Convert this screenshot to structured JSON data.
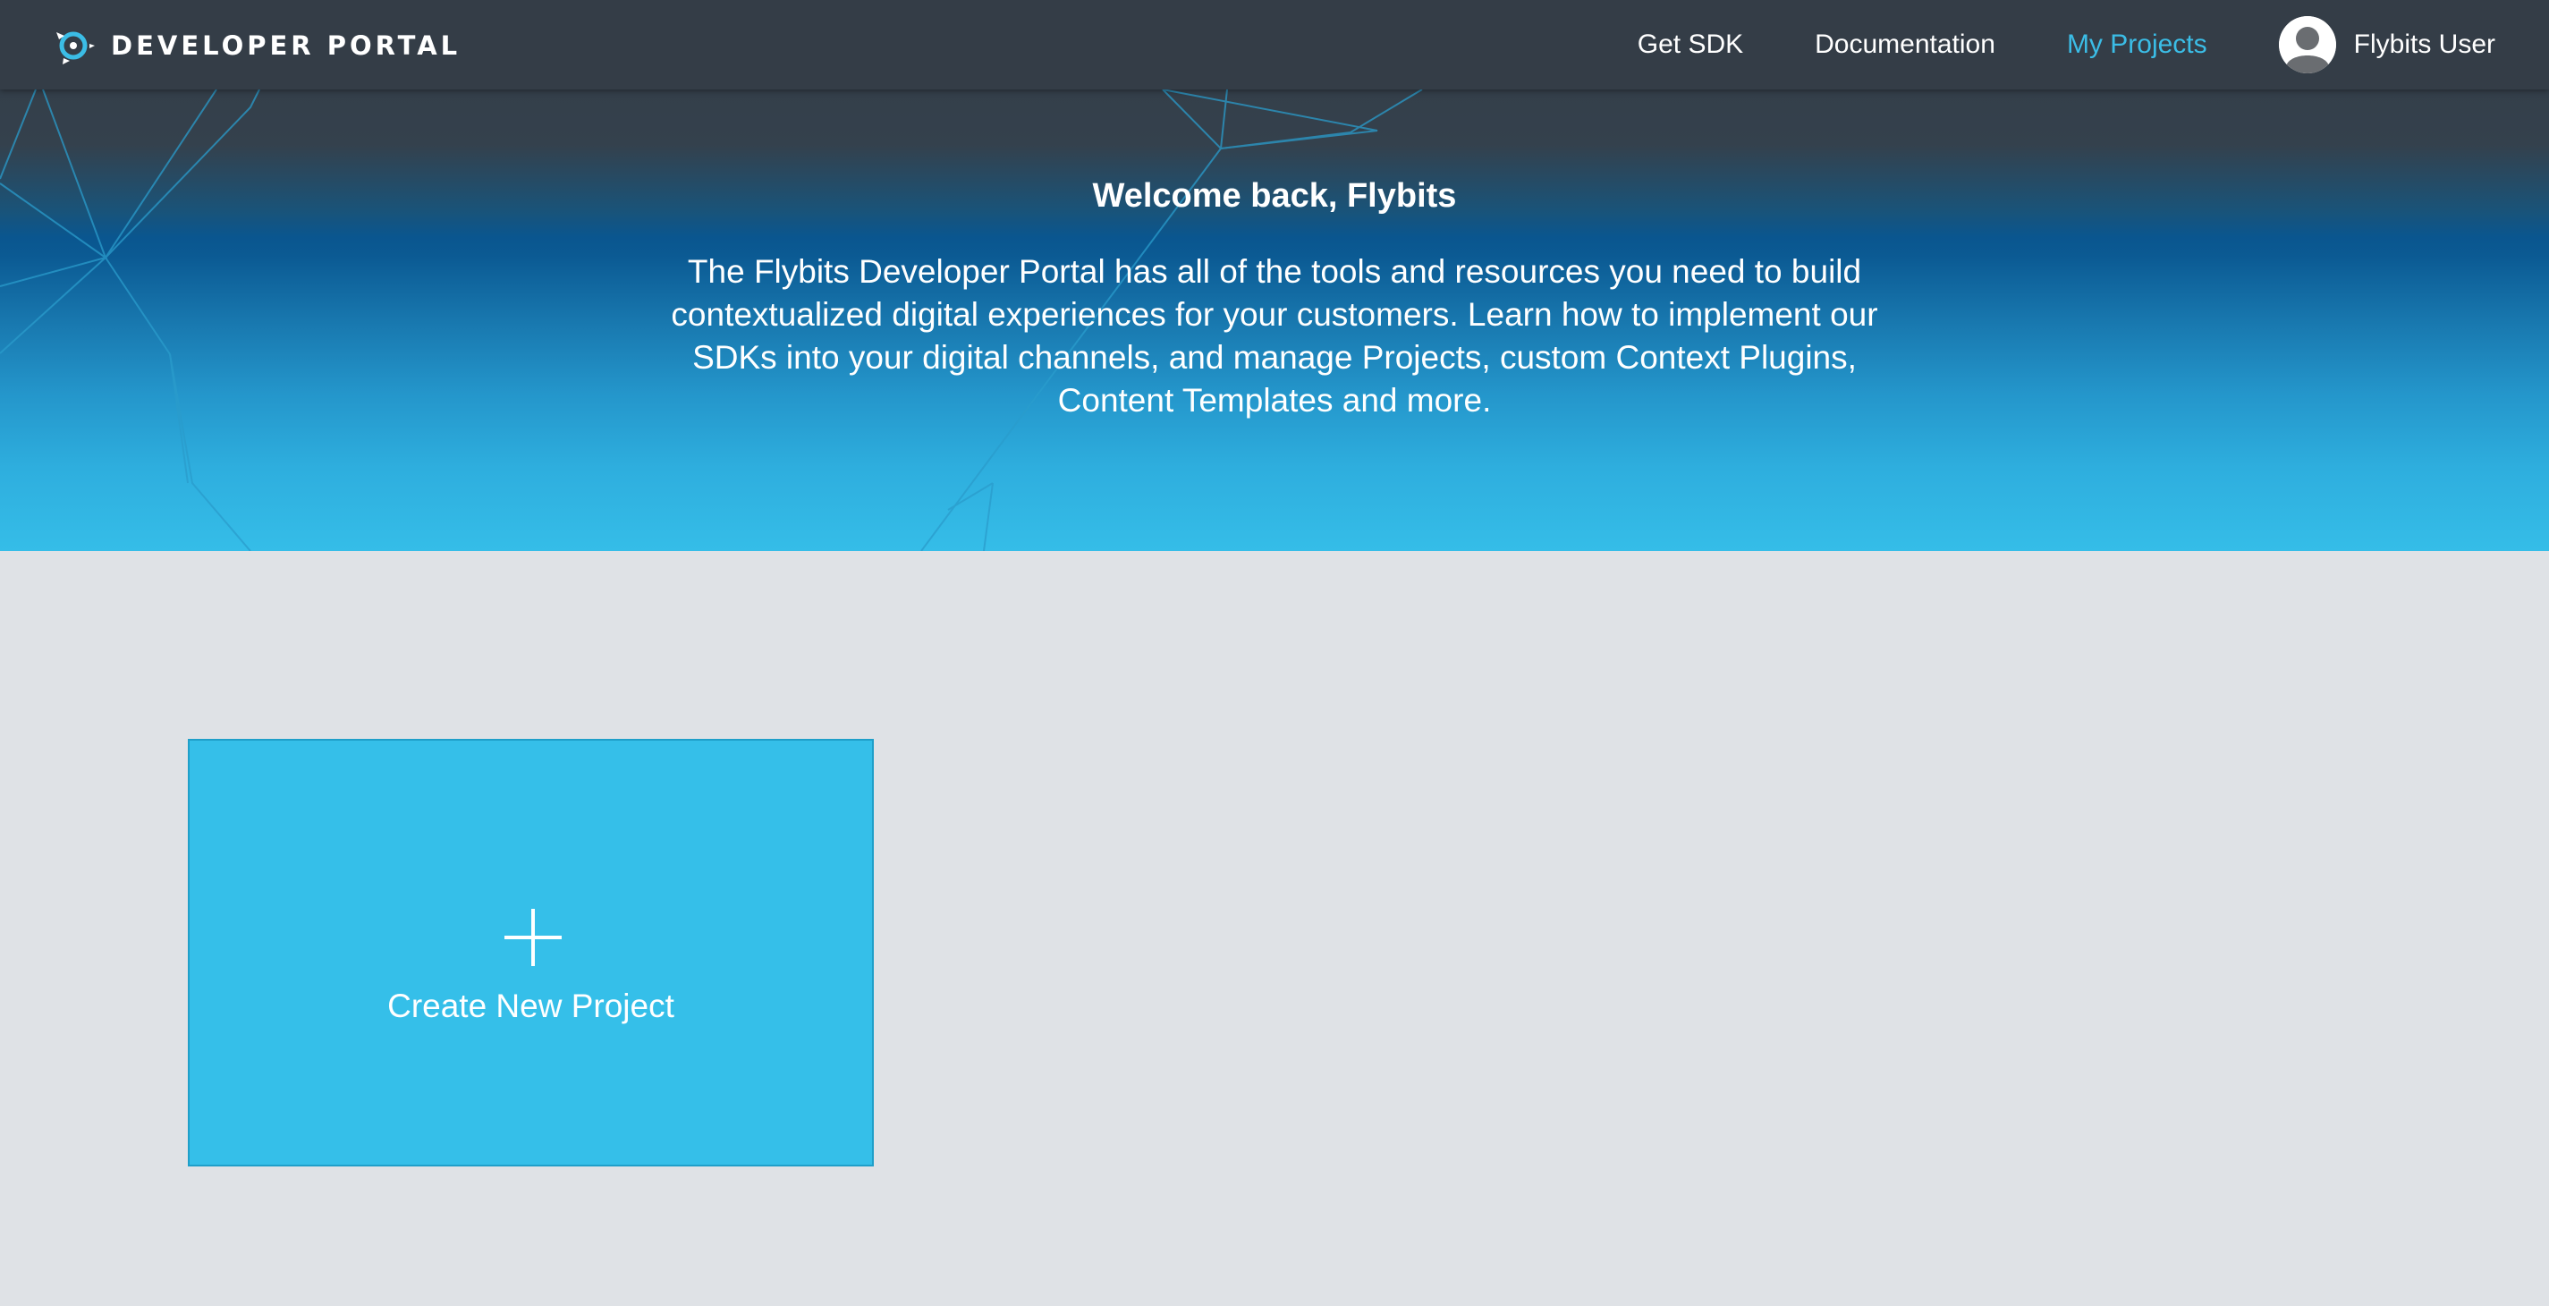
{
  "nav": {
    "brand": "DEVELOPER PORTAL",
    "brand_icon": "flybits-logo-icon",
    "links": [
      {
        "label": "Get SDK",
        "active": false
      },
      {
        "label": "Documentation",
        "active": false
      },
      {
        "label": "My Projects",
        "active": true
      }
    ],
    "user": {
      "name": "Flybits User",
      "avatar_icon": "user-avatar-icon"
    },
    "active_color": "#3bbde6"
  },
  "hero": {
    "title": "Welcome back, Flybits",
    "description": "The Flybits Developer Portal has all of the tools and resources you need to build contextualized digital experiences for your customers. Learn how to implement our SDKs into your digital channels, and manage Projects, custom Context Plugins, Content Templates and more."
  },
  "projects": {
    "create_label": "Create New Project",
    "create_icon": "plus-icon",
    "card_color": "#35bfe9"
  },
  "colors": {
    "nav_background": "#343d47",
    "page_background": "#dfe2e6"
  }
}
